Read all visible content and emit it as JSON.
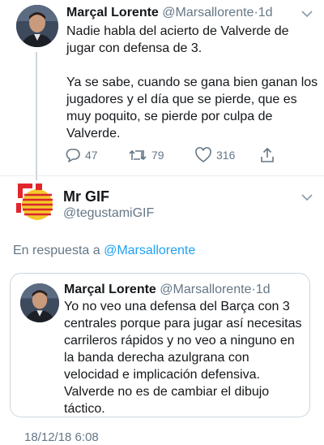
{
  "tweet": {
    "author_name": "Marçal Lorente",
    "author_handle": "@Marsallorente",
    "separator": "·",
    "time": "1d",
    "paragraph1": "Nadie habla del acierto de Valverde de jugar con defensa de 3.",
    "paragraph2": "Ya se sabe, cuando se gana bien ganan los jugadores y el día que se pierde, que es muy poquito, se pierde por culpa de Valverde.",
    "replies": "47",
    "retweets": "79",
    "likes": "316"
  },
  "reply": {
    "author_name": "Mr GIF",
    "author_handle": "@tegustamiGIF",
    "replying_prefix": "En respuesta a",
    "replying_to": "@Marsallorente",
    "timestamp": "18/12/18 6:08"
  },
  "quoted": {
    "author_name": "Marçal Lorente",
    "author_handle": "@Marsallorente",
    "separator": "·",
    "time": "1d",
    "text": "Yo no veo una defensa del Barça con 3 centrales porque para jugar así necesitas carrileros rápidos y no veo a ninguno en la banda derecha azulgrana con velocidad e implicación defensiva. Valverde no es de cambiar el dibujo táctico."
  },
  "icons": {
    "reply": "reply-icon",
    "retweet": "retweet-icon",
    "like": "heart-icon",
    "share": "share-icon",
    "menu": "chevron-down-icon"
  },
  "colors": {
    "link": "#1da1f2",
    "secondary_text": "#657786",
    "border": "#ccd6dd"
  }
}
